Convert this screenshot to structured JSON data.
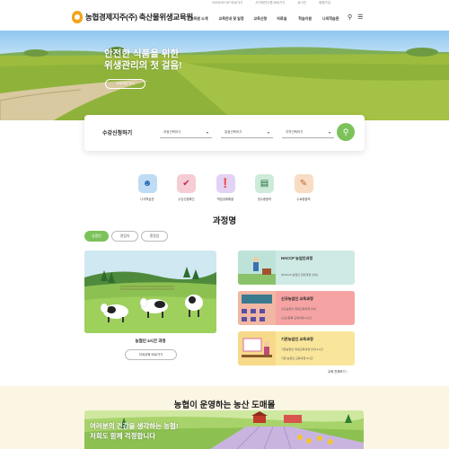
{
  "util_links": [
    "NONGHYUP 바로가기",
    "사이버연수원 바로가기",
    "로그인",
    "회원가입"
  ],
  "logo": {
    "text": "농협경제지주(주) 축산물위생교육원"
  },
  "gnb": [
    "교육원 소개",
    "교육안내 및 일정",
    "교육신청",
    "자료실",
    "학습지원",
    "나의학습관"
  ],
  "icons": {
    "search": "search-icon",
    "menu": "hamburger-menu-icon"
  },
  "hero": {
    "title_line1": "안전한 식품을 위한",
    "title_line2": "위생관리의 첫 걸음!",
    "button": "교육과정 보기"
  },
  "search": {
    "title": "수강신청하기",
    "select1": "과정선택하기",
    "select2": "일정선택하기",
    "select3": "지역선택하기"
  },
  "quick_menu": [
    {
      "label": "나의학습관",
      "icon": "user-icon",
      "bg": "#bfdcf4",
      "color": "#2f6fb5"
    },
    {
      "label": "수강신청확인",
      "icon": "check-icon",
      "bg": "#f6cdd5",
      "color": "#c0304a"
    },
    {
      "label": "학습장애해결",
      "icon": "alert-icon",
      "bg": "#e4d2f4",
      "color": "#7a2fb5"
    },
    {
      "label": "영수증출력",
      "icon": "receipt-icon",
      "bg": "#cdebd8",
      "color": "#1f6b3a"
    },
    {
      "label": "수료증출력",
      "icon": "certificate-icon",
      "bg": "#f8dcc4",
      "color": "#c0682a"
    }
  ],
  "course_section": {
    "title": "과정명",
    "tabs": [
      "농협인",
      "영업자",
      "종원업"
    ]
  },
  "featured": {
    "title": "농협인 4시간 과정",
    "button": "자세교육 바로가기"
  },
  "cards": [
    {
      "title": "HACCP 농업인과정",
      "desc1": "[HACCP 농업인 관련과정 안내]",
      "desc2": "",
      "bg": "#cfe9e4"
    },
    {
      "title": "신규농업인 교육과정",
      "desc1": "신규농업인 위생교육과정 안내",
      "desc2": "(신규)등록 교육과정 4시간",
      "bg": "#f6a3a3"
    },
    {
      "title": "기존농업인 교육과정",
      "desc1": "기존농업인 위생교육과정 안내 4시간",
      "desc2": "기존 농업인 교육과정 6시간",
      "bg": "#f9e69a"
    }
  ],
  "more_link": "교육 전체보기",
  "bottom": {
    "title": "농협이 운영하는 농산 도매몰",
    "banner_line1": "여러분의 건강을 생각하는 농협!",
    "banner_line2": "저희도 함께 걱정합니다"
  }
}
